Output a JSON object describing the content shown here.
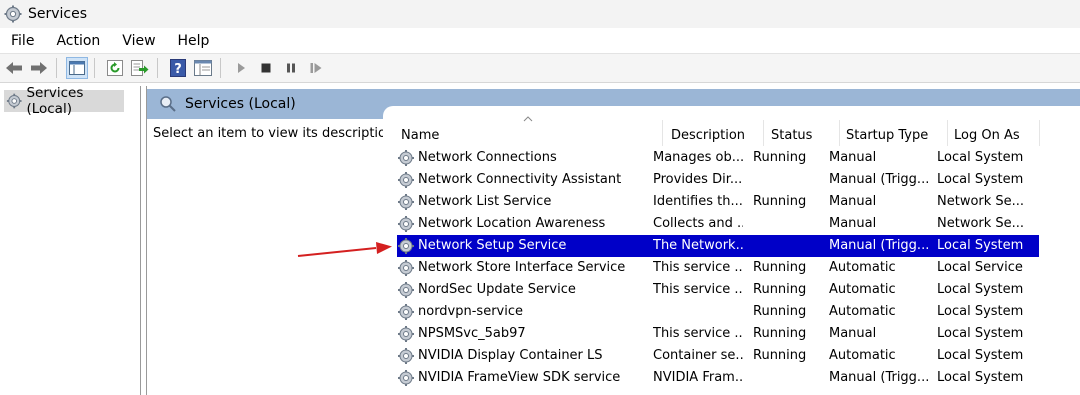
{
  "window": {
    "title": "Services"
  },
  "menu": [
    "File",
    "Action",
    "View",
    "Help"
  ],
  "toolbar_icons": [
    "back-arrow-icon",
    "forward-arrow-icon",
    "console-tree-icon",
    "refresh-icon",
    "export-list-icon",
    "help-icon",
    "properties-icon",
    "play-icon",
    "stop-icon",
    "pause-icon",
    "restart-icon"
  ],
  "tree": {
    "items": [
      {
        "label": "Services (Local)",
        "icon": "services-gear-icon"
      }
    ]
  },
  "main": {
    "header_title": "Services (Local)",
    "description_prompt": "Select an item to view its description."
  },
  "columns": [
    "Name",
    "Description",
    "Status",
    "Startup Type",
    "Log On As"
  ],
  "services": [
    {
      "name": "Network Connections",
      "description": "Manages ob...",
      "status": "Running",
      "startup": "Manual",
      "logon": "Local System"
    },
    {
      "name": "Network Connectivity Assistant",
      "description": "Provides Dir...",
      "status": "",
      "startup": "Manual (Trigg...",
      "logon": "Local System"
    },
    {
      "name": "Network List Service",
      "description": "Identifies th...",
      "status": "Running",
      "startup": "Manual",
      "logon": "Network Se..."
    },
    {
      "name": "Network Location Awareness",
      "description": "Collects and ...",
      "status": "",
      "startup": "Manual",
      "logon": "Network Se..."
    },
    {
      "name": "Network Setup Service",
      "description": "The Network...",
      "status": "",
      "startup": "Manual (Trigg...",
      "logon": "Local System",
      "selected": true
    },
    {
      "name": "Network Store Interface Service",
      "description": "This service ...",
      "status": "Running",
      "startup": "Automatic",
      "logon": "Local Service"
    },
    {
      "name": "NordSec Update Service",
      "description": "This service ...",
      "status": "Running",
      "startup": "Automatic",
      "logon": "Local System"
    },
    {
      "name": "nordvpn-service",
      "description": "",
      "status": "Running",
      "startup": "Automatic",
      "logon": "Local System"
    },
    {
      "name": "NPSMSvc_5ab97",
      "description": "This service ...",
      "status": "Running",
      "startup": "Manual",
      "logon": "Local System"
    },
    {
      "name": "NVIDIA Display Container LS",
      "description": "Container se...",
      "status": "Running",
      "startup": "Automatic",
      "logon": "Local System"
    },
    {
      "name": "NVIDIA FrameView SDK service",
      "description": "NVIDIA Fram...",
      "status": "",
      "startup": "Manual (Trigg...",
      "logon": "Local System"
    }
  ],
  "colors": {
    "selection": "#0000c8",
    "header_band": "#9bb6d6",
    "annotation_arrow": "#d42020"
  }
}
